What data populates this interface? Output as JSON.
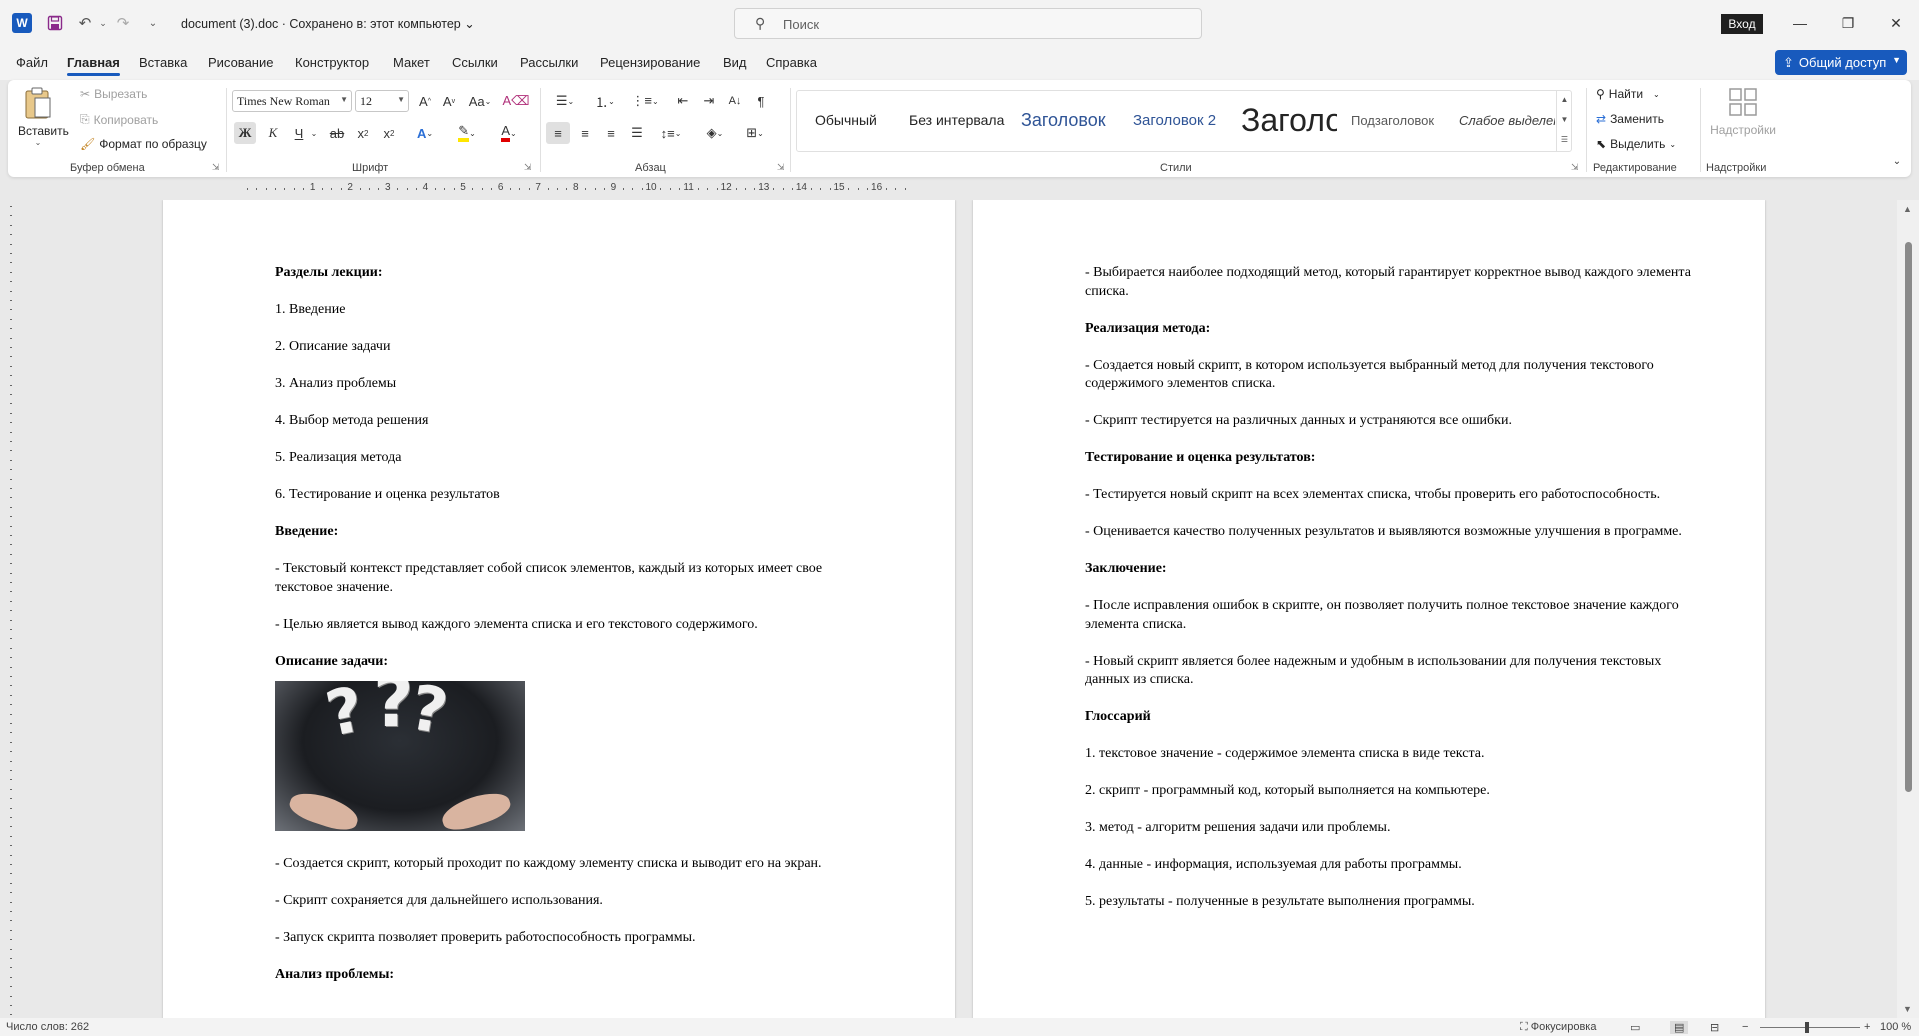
{
  "titlebar": {
    "doc_title": "document (3).doc  ·  Сохранено в: этот компьютер  ⌄",
    "search_placeholder": "Поиск",
    "signin": "Вход"
  },
  "menu": {
    "tabs": [
      "Файл",
      "Главная",
      "Вставка",
      "Рисование",
      "Конструктор",
      "Макет",
      "Ссылки",
      "Рассылки",
      "Рецензирование",
      "Вид",
      "Справка"
    ],
    "active": "Главная",
    "share": "Общий доступ"
  },
  "ribbon": {
    "clipboard": {
      "paste": "Вставить",
      "cut": "Вырезать",
      "copy": "Копировать",
      "format_painter": "Формат по образцу",
      "label": "Буфер обмена"
    },
    "font": {
      "name": "Times New Roman",
      "size": "12",
      "label": "Шрифт"
    },
    "paragraph": {
      "label": "Абзац"
    },
    "styles": {
      "items": [
        "Обычный",
        "Без интервала",
        "Заголовок",
        "Заголовок 2",
        "Заголовок",
        "Подзаголовок",
        "Слабое выделение"
      ],
      "label": "Стили"
    },
    "editing": {
      "find": "Найти",
      "replace": "Заменить",
      "select": "Выделить",
      "label": "Редактирование"
    },
    "addins": {
      "button": "Надстройки",
      "label": "Надстройки"
    }
  },
  "ruler": {
    "numbers": [
      "1",
      "2",
      "3",
      "4",
      "5",
      "6",
      "7",
      "8",
      "9",
      "10",
      "11",
      "12",
      "13",
      "14",
      "15",
      "16"
    ]
  },
  "page1": {
    "p1": "Разделы лекции:",
    "p2": "1. Введение",
    "p3": "2. Описание задачи",
    "p4": "3. Анализ проблемы",
    "p5": "4. Выбор метода решения",
    "p6": "5. Реализация метода",
    "p7": "6. Тестирование и оценка результатов",
    "p8": "Введение:",
    "p9": "- Текстовый контекст представляет собой список элементов, каждый из которых имеет свое текстовое значение.",
    "p10": "- Целью является вывод каждого элемента списка и его текстового содержимого.",
    "p11": "Описание задачи:",
    "p12": "- Создается скрипт, который проходит по каждому элементу списка и выводит его на экран.",
    "p13": "- Скрипт сохраняется для дальнейшего использования.",
    "p14": "- Запуск скрипта позволяет проверить работоспособность программы.",
    "p15": "Анализ проблемы:"
  },
  "page2": {
    "p1": "- Выбирается наиболее подходящий метод, который гарантирует корректное вывод каждого элемента списка.",
    "p2": "Реализация метода:",
    "p3": "- Создается новый скрипт, в котором используется выбранный метод для получения текстового содержимого элементов списка.",
    "p4": "- Скрипт тестируется на различных данных и устраняются все ошибки.",
    "p5": "Тестирование и оценка результатов:",
    "p6": "- Тестируется новый скрипт на всех элементах списка, чтобы проверить его работоспособность.",
    "p7": "- Оценивается качество полученных результатов и выявляются возможные улучшения в программе.",
    "p8": "Заключение:",
    "p9": "- После исправления ошибок в скрипте, он позволяет получить полное текстовое значение каждого элемента списка.",
    "p10": "- Новый скрипт является более надежным и удобным в использовании для получения текстовых данных из списка.",
    "p11": "Глоссарий",
    "p12": "1. текстовое значение - содержимое элемента списка в виде текста.",
    "p13": "2. скрипт - программный код, который выполняется на компьютере.",
    "p14": "3. метод - алгоритм решения задачи или проблемы.",
    "p15": "4. данные - информация, используемая для работы программы.",
    "p16": "5. результаты - полученные в результате выполнения программы."
  },
  "status": {
    "word_count": "Число слов: 262",
    "focus": "Фокусировка",
    "zoom": "100 %"
  },
  "colors": {
    "accent": "#185abd",
    "chrome": "#f3f3f3",
    "canvas": "#e9e9e9"
  }
}
